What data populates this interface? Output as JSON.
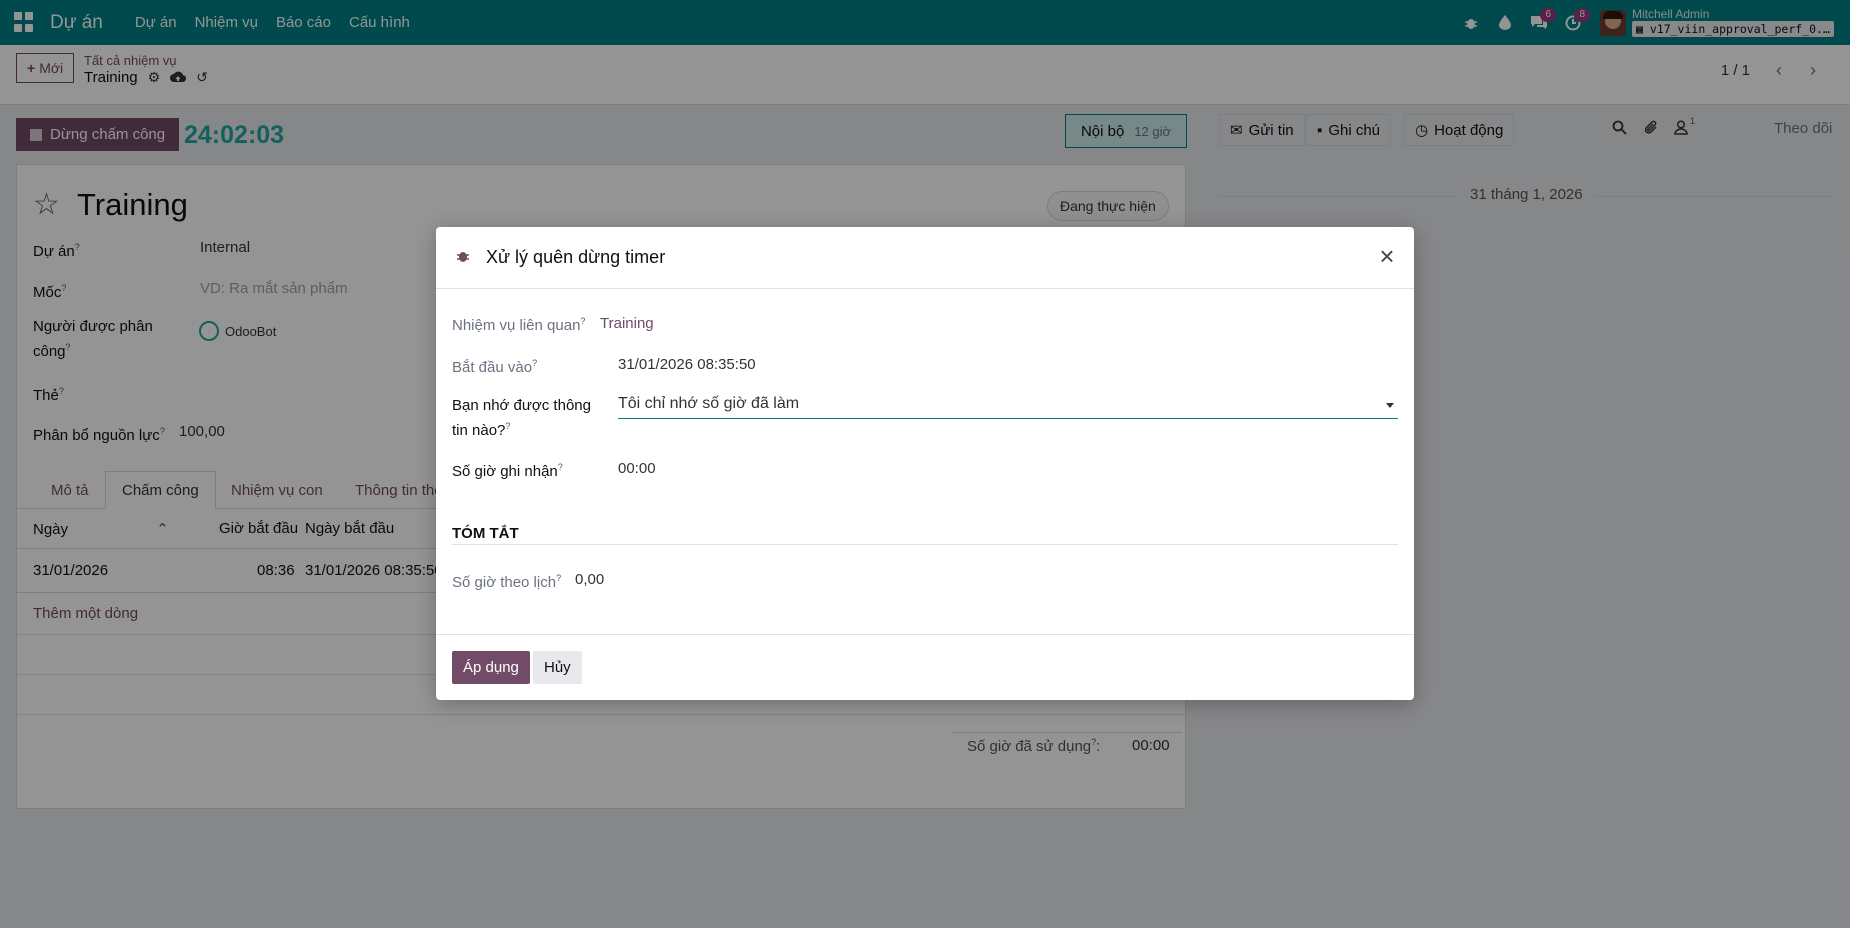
{
  "navbar": {
    "brand": "Dự án",
    "menu": [
      "Dự án",
      "Nhiệm vụ",
      "Báo cáo",
      "Cấu hình"
    ],
    "messages_count": "6",
    "activities_count": "8",
    "user_name": "Mitchell Admin",
    "database": "v17_viin_approval_perf_0..."
  },
  "control": {
    "new_label": "Mới",
    "breadcrumb_parent": "Tất cả nhiệm vụ",
    "breadcrumb_current": "Training",
    "pager": "1 / 1"
  },
  "form": {
    "timer_button": "Dừng chấm công",
    "timer_value": "24:02:03",
    "project_badge": "Nội bộ",
    "project_badge_hours": "12 giờ",
    "title": "Training",
    "stage": "Đang thực hiện",
    "fields": {
      "project_label": "Dự án",
      "project_value": "Internal",
      "milestone_label": "Mốc",
      "milestone_placeholder": "VD: Ra mắt sản phẩm",
      "assignee_label_1": "Người được phân",
      "assignee_label_2": "công",
      "assignee_value": "OdooBot",
      "tags_label": "Thẻ",
      "allocation_label": "Phân bổ nguồn lực",
      "allocation_value": "100,00"
    },
    "tabs": [
      "Mô tả",
      "Chấm công",
      "Nhiệm vụ con",
      "Thông tin thêm"
    ],
    "table": {
      "headers": [
        "Ngày",
        "Giờ bắt đầu",
        "Ngày bắt đầu"
      ],
      "row": [
        "31/01/2026",
        "08:36",
        "31/01/2026 08:35:50"
      ],
      "add_line": "Thêm một dòng"
    },
    "used_hours_label": "Số giờ đã sử dụng",
    "used_hours_value": "00:00"
  },
  "chatter": {
    "send_message": "Gửi tin",
    "log_note": "Ghi chú",
    "activities": "Hoạt động",
    "followers_count": "1",
    "follow": "Theo dõi",
    "date_separator": "31 tháng 1, 2026"
  },
  "modal": {
    "title": "Xử lý quên dừng timer",
    "related_task_label": "Nhiệm vụ liên quan",
    "related_task_value": "Training",
    "start_label": "Bắt đầu vào",
    "start_value": "31/01/2026 08:35:50",
    "remember_label_1": "Bạn nhớ được thông",
    "remember_label_2": "tin nào?",
    "remember_value": "Tôi chỉ nhớ số giờ đã làm",
    "hours_label": "Số giờ ghi nhận",
    "hours_value": "00:00",
    "summary_title": "TÓM TẮT",
    "scheduled_label": "Số giờ theo lịch",
    "scheduled_value": "0,00",
    "apply": "Áp dụng",
    "cancel": "Hủy"
  }
}
